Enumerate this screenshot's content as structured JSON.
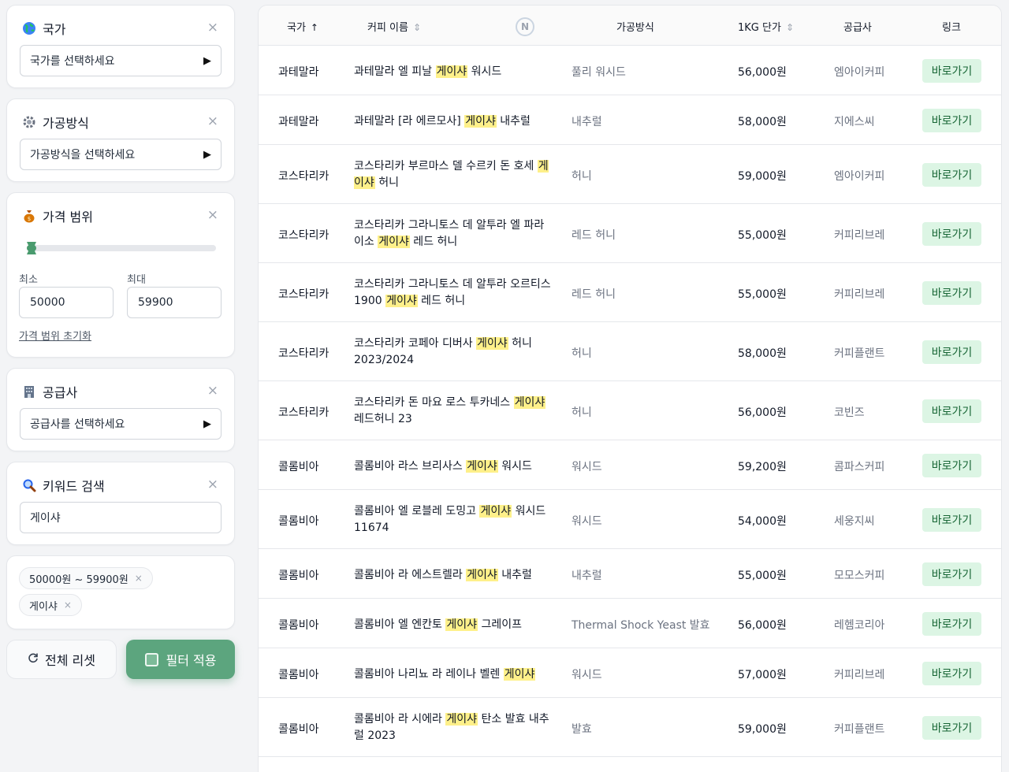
{
  "filters": {
    "country": {
      "icon": "globe-icon",
      "title": "국가",
      "placeholder": "국가를 선택하세요"
    },
    "method": {
      "icon": "gear-icon",
      "title": "가공방식",
      "placeholder": "가공방식을 선택하세요"
    },
    "price": {
      "icon": "money-bag-icon",
      "title": "가격 범위",
      "min_label": "최소",
      "max_label": "최대",
      "min_value": "50000",
      "max_value": "59900",
      "reset_label": "가격 범위 초기화",
      "slider_fill_fraction": 0.02
    },
    "supplier": {
      "icon": "building-icon",
      "title": "공급사",
      "placeholder": "공급사를 선택하세요"
    },
    "keyword": {
      "icon": "magnifier-icon",
      "title": "키워드 검색",
      "value": "게이샤"
    },
    "close_glyph": "×",
    "caret_glyph": "▶"
  },
  "active_chips": [
    "50000원 ~ 59900원",
    "게이샤"
  ],
  "chip_close_glyph": "×",
  "buttons": {
    "reset_label": "전체 리셋",
    "apply_label": "필터 적용"
  },
  "table": {
    "headers": {
      "country": "국가",
      "country_sort": "↑",
      "name": "커피 이름",
      "name_sort": "⇕",
      "n_badge": "N",
      "method": "가공방식",
      "price": "1KG 단가",
      "price_sort": "⇕",
      "supplier": "공급사",
      "link": "링크"
    },
    "highlight": "게이샤",
    "link_label": "바로가기",
    "rows": [
      {
        "country": "과테말라",
        "name_before": "과테말라 엘 피날 ",
        "name_after": " 워시드",
        "method": "풀리 워시드",
        "price": "56,000원",
        "supplier": "엠아이커피"
      },
      {
        "country": "과테말라",
        "name_before": "과테말라 [라 에르모사] ",
        "name_after": " 내추럴",
        "method": "내추럴",
        "price": "58,000원",
        "supplier": "지에스씨"
      },
      {
        "country": "코스타리카",
        "name_before": "코스타리카 부르마스 델 수르키 돈 호세 ",
        "name_after": " 허니",
        "method": "허니",
        "price": "59,000원",
        "supplier": "엠아이커피"
      },
      {
        "country": "코스타리카",
        "name_before": "코스타리카 그라니토스 데 알투라 엘 파라이소 ",
        "name_after": " 레드 허니",
        "method": "레드 허니",
        "price": "55,000원",
        "supplier": "커피리브레"
      },
      {
        "country": "코스타리카",
        "name_before": "코스타리카 그라니토스 데 알투라 오르티스 1900 ",
        "name_after": " 레드 허니",
        "method": "레드 허니",
        "price": "55,000원",
        "supplier": "커피리브레"
      },
      {
        "country": "코스타리카",
        "name_before": "코스타리카 코페아 디버사 ",
        "name_after": " 허니 2023/2024",
        "method": "허니",
        "price": "58,000원",
        "supplier": "커피플랜트"
      },
      {
        "country": "코스타리카",
        "name_before": "코스타리카 돈 마요 로스 투카네스 ",
        "name_after": " 레드허니 23",
        "method": "허니",
        "price": "56,000원",
        "supplier": "코빈즈"
      },
      {
        "country": "콜롬비아",
        "name_before": "콜롬비아 라스 브리사스 ",
        "name_after": " 워시드",
        "method": "워시드",
        "price": "59,200원",
        "supplier": "콤파스커피"
      },
      {
        "country": "콜롬비아",
        "name_before": "콜롬비아 엘 로블레 도밍고 ",
        "name_after": " 워시드 11674",
        "method": "워시드",
        "price": "54,000원",
        "supplier": "세웅지씨"
      },
      {
        "country": "콜롬비아",
        "name_before": "콜롬비아 라 에스트렐라 ",
        "name_after": " 내추럴",
        "method": "내추럴",
        "price": "55,000원",
        "supplier": "모모스커피"
      },
      {
        "country": "콜롬비아",
        "name_before": "콜롬비아 엘 엔칸토 ",
        "name_after": " 그레이프",
        "method": "Thermal Shock Yeast 발효",
        "price": "56,000원",
        "supplier": "레헴코리아"
      },
      {
        "country": "콜롬비아",
        "name_before": "콜롬비아 나리뇨 라 레이나 벨렌 ",
        "name_after": "",
        "method": "워시드",
        "price": "57,000원",
        "supplier": "커피리브레"
      },
      {
        "country": "콜롬비아",
        "name_before": "콜롬비아 라 시에라 ",
        "name_after": " 탄소 발효 내추럴 2023",
        "method": "발효",
        "price": "59,000원",
        "supplier": "커피플랜트"
      }
    ]
  }
}
